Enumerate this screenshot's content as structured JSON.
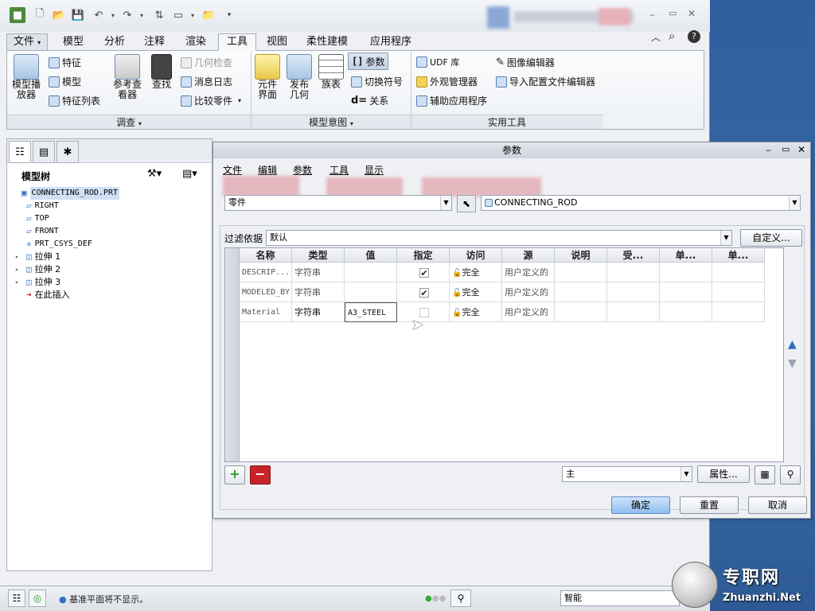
{
  "ribbon": {
    "tabs": [
      "文件",
      "模型",
      "分析",
      "注释",
      "渲染",
      "工具",
      "视图",
      "柔性建模",
      "应用程序"
    ],
    "file_arrow": "▾",
    "groups": {
      "investigate": {
        "label": "调查",
        "model_player": "模型播\n放器",
        "feature": "特征",
        "model": "模型",
        "feature_list": "特征列表",
        "ref_viewer": "参考查\n看器",
        "find": "查找",
        "geom_check": "几何检查",
        "msg_log": "消息日志",
        "compare": "比较零件"
      },
      "model_intent": {
        "label": "模型意图",
        "component_interface": "元件\n界面",
        "publish_geom": "发布\n几何",
        "family_table": "族表",
        "parameters": "参数",
        "switch_symbols": "切换符号",
        "relations": "关系"
      },
      "utilities": {
        "label": "实用工具",
        "udf_library": "UDF 库",
        "appearance_mgr": "外观管理器",
        "aux_apps": "辅助应用程序",
        "image_editor": "图像编辑器",
        "import_config_editor": "导入配置文件编辑器"
      }
    }
  },
  "model_tree": {
    "title": "模型树",
    "items": [
      {
        "label": "CONNECTING_ROD.PRT",
        "level": 0,
        "icon": "part-icon",
        "expandable": false,
        "selected": true
      },
      {
        "label": "RIGHT",
        "level": 1,
        "icon": "datum-plane-icon",
        "expandable": false
      },
      {
        "label": "TOP",
        "level": 1,
        "icon": "datum-plane-icon",
        "expandable": false
      },
      {
        "label": "FRONT",
        "level": 1,
        "icon": "datum-plane-icon",
        "expandable": false
      },
      {
        "label": "PRT_CSYS_DEF",
        "level": 1,
        "icon": "csys-icon",
        "expandable": false
      },
      {
        "label": "拉伸 1",
        "level": 1,
        "icon": "extrude-icon",
        "expandable": true
      },
      {
        "label": "拉伸 2",
        "level": 1,
        "icon": "extrude-icon",
        "expandable": true
      },
      {
        "label": "拉伸 3",
        "level": 1,
        "icon": "extrude-icon",
        "expandable": true
      },
      {
        "label": "在此插入",
        "level": 1,
        "icon": "insert-arrow-icon",
        "expandable": false
      }
    ]
  },
  "dialog": {
    "title": "参数",
    "menu": [
      "文件",
      "编辑",
      "参数",
      "工具",
      "显示"
    ],
    "lookin_type": "零件",
    "lookin_object": "CONNECTING_ROD",
    "filter_label": "过滤依据",
    "filter_value": "默认",
    "customize_btn": "自定义...",
    "columns": [
      "名称",
      "类型",
      "值",
      "指定",
      "访问",
      "源",
      "说明",
      "受...",
      "单...",
      "单..."
    ],
    "rows": [
      {
        "name": "DESCRIP...",
        "type": "字符串",
        "value": "",
        "designated": true,
        "access": "完全",
        "source": "用户定义的"
      },
      {
        "name": "MODELED_BY",
        "type": "字符串",
        "value": "",
        "designated": true,
        "access": "完全",
        "source": "用户定义的"
      },
      {
        "name": "Material",
        "type": "字符串",
        "value": "A3_STEEL",
        "designated": false,
        "access": "完全",
        "source": "用户定义的"
      }
    ],
    "add_btn": "+",
    "remove_btn": "−",
    "main_select": "主",
    "properties_btn": "属性...",
    "ok_btn": "确定",
    "reset_btn": "重置",
    "cancel_btn": "取消"
  },
  "status_bar": {
    "message": "基准平面将不显示。",
    "smart_select": "智能"
  },
  "watermark": {
    "title": "专职网",
    "url": "Zhuanzhi.Net"
  },
  "colors": {
    "accent": "#2f6fbf",
    "add_green": "#2a9a2a",
    "remove_red": "#c8232a",
    "ok_blue": "#8fbdf0"
  }
}
